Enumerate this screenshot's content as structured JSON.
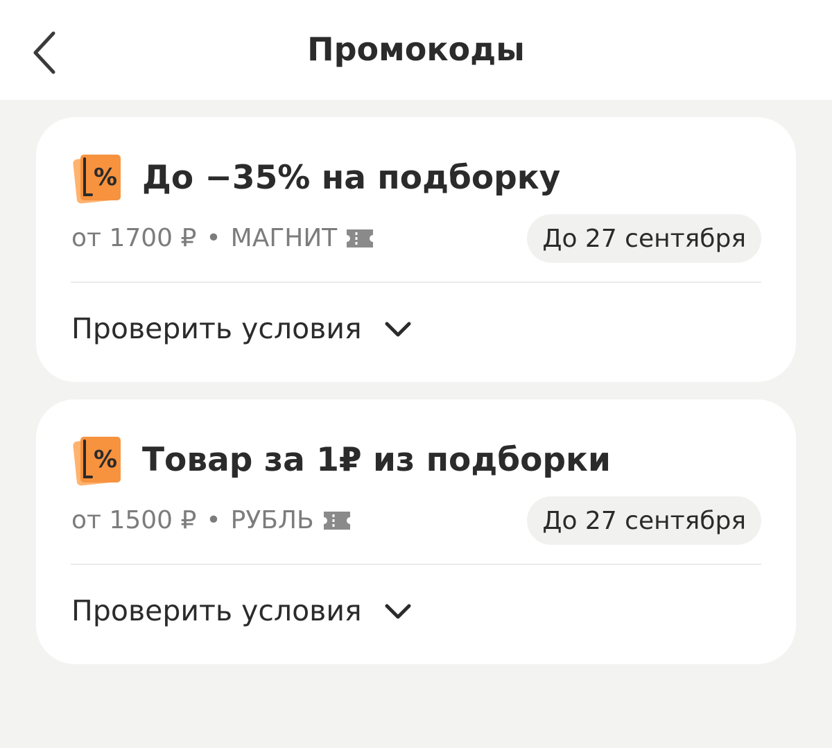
{
  "header": {
    "title": "Промокоды",
    "back_icon": "chevron-left-icon"
  },
  "promos": [
    {
      "title": "До −35% на подборку",
      "min_order": "от 1700 ₽",
      "separator": "•",
      "shop": "МАГНИТ",
      "expiry": "До 27 сентября",
      "conditions_label": "Проверить условия",
      "icon": "percent-tag-icon"
    },
    {
      "title": "Товар за 1₽ из подборки",
      "min_order": "от 1500 ₽",
      "separator": "•",
      "shop": "РУБЛЬ",
      "expiry": "До 27 сентября",
      "conditions_label": "Проверить условия",
      "icon": "percent-tag-icon"
    }
  ],
  "colors": {
    "accent": "#f7923f",
    "accent_dark": "#ffb36e",
    "background": "#f3f3f1",
    "card": "#ffffff",
    "muted_text": "#7c7c7c"
  }
}
